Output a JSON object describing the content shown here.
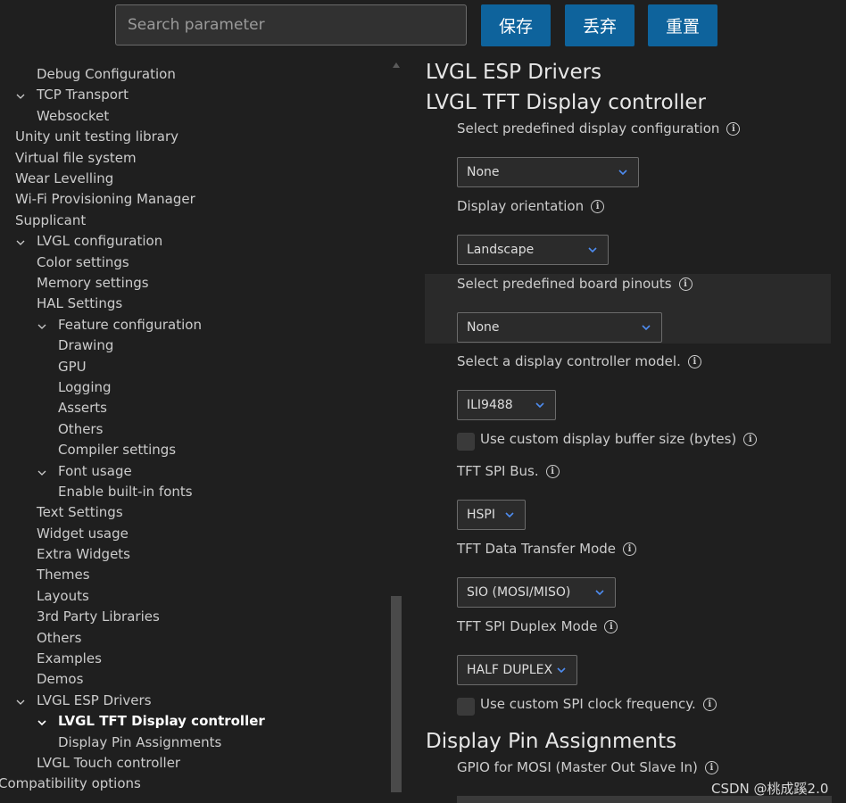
{
  "search": {
    "placeholder": "Search parameter"
  },
  "toolbar": {
    "save_label": "保存",
    "discard_label": "丢弃",
    "reset_label": "重置"
  },
  "sidebar": {
    "items": [
      {
        "label": "Debug Configuration"
      },
      {
        "label": "TCP Transport"
      },
      {
        "label": "Websocket"
      },
      {
        "label": "Unity unit testing library"
      },
      {
        "label": "Virtual file system"
      },
      {
        "label": "Wear Levelling"
      },
      {
        "label": "Wi-Fi Provisioning Manager"
      },
      {
        "label": "Supplicant"
      },
      {
        "label": "LVGL configuration"
      },
      {
        "label": "Color settings"
      },
      {
        "label": "Memory settings"
      },
      {
        "label": "HAL Settings"
      },
      {
        "label": "Feature configuration"
      },
      {
        "label": "Drawing"
      },
      {
        "label": "GPU"
      },
      {
        "label": "Logging"
      },
      {
        "label": "Asserts"
      },
      {
        "label": "Others"
      },
      {
        "label": "Compiler settings"
      },
      {
        "label": "Font usage"
      },
      {
        "label": "Enable built-in fonts"
      },
      {
        "label": "Text Settings"
      },
      {
        "label": "Widget usage"
      },
      {
        "label": "Extra Widgets"
      },
      {
        "label": "Themes"
      },
      {
        "label": "Layouts"
      },
      {
        "label": "3rd Party Libraries"
      },
      {
        "label": "Others"
      },
      {
        "label": "Examples"
      },
      {
        "label": "Demos"
      },
      {
        "label": "LVGL ESP Drivers"
      },
      {
        "label": "LVGL TFT Display controller"
      },
      {
        "label": "Display Pin Assignments"
      },
      {
        "label": "LVGL Touch controller"
      },
      {
        "label": "Compatibility options"
      }
    ]
  },
  "main": {
    "section_drivers": "LVGL ESP Drivers",
    "section_tft": "LVGL TFT Display controller",
    "predefined_display_label": "Select predefined display configuration",
    "predefined_display_value": "None",
    "orientation_label": "Display orientation",
    "orientation_value": "Landscape",
    "board_pinouts_label": "Select predefined board pinouts",
    "board_pinouts_value": "None",
    "controller_model_label": "Select a display controller model.",
    "controller_model_value": "ILI9488",
    "custom_buffer_label": "Use custom display buffer size (bytes)",
    "spi_bus_label": "TFT SPI Bus.",
    "spi_bus_value": "HSPI",
    "transfer_mode_label": "TFT Data Transfer Mode",
    "transfer_mode_value": "SIO (MOSI/MISO)",
    "duplex_mode_label": "TFT SPI Duplex Mode",
    "duplex_mode_value": "HALF DUPLEX",
    "custom_clock_label": "Use custom SPI clock frequency.",
    "section_pins": "Display Pin Assignments",
    "gpio_mosi_label": "GPIO for MOSI (Master Out Slave In)"
  },
  "watermark": "CSDN @桃成蹊2.0",
  "colors": {
    "accent": "#0e639c",
    "background": "#1f1f1f",
    "caret": "#4e8cf0"
  },
  "icons": {
    "info": "info-icon",
    "chevron_down": "chevron-down-icon",
    "dropdown_caret": "caret-down-icon"
  }
}
